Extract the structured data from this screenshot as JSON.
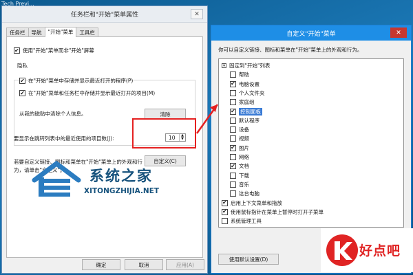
{
  "background": {
    "caption": "Tech Previ..."
  },
  "win1": {
    "title": "任务栏和\"开始\"菜单属性",
    "close": "✕",
    "tabs": [
      "任务栏",
      "导航",
      "\"开始\"菜单",
      "工具栏"
    ],
    "active_tab": 2,
    "use_start_menu": "使用\"开始\"菜单而非\"开始\"屏幕",
    "privacy_label": "隐私",
    "privacy_opt1": "在\"开始\"菜单中存储并显示最近打开的程序(P)",
    "privacy_opt2": "在\"开始\"菜单和任务栏中存储并显示最近打开的项目(M)",
    "clear_history_text": "从我的磁贴中清除个人信息。",
    "clear_button": "清除",
    "jump_list_label": "要显示在跳转列表中的最近使用的项目数(J):",
    "jump_list_value": "10",
    "customize_text_line1": "若要自定义链接、图标和菜单在\"开始\"菜单上的外观和行",
    "customize_text_line2": "为，请单击\"自定义\"。",
    "customize_button": "自定义(C)",
    "ok_button": "确定",
    "cancel_button": "取消",
    "apply_button": "应用(A)"
  },
  "logo": {
    "text": "系统之家",
    "url": "XITONGZHIJIA.NET"
  },
  "win2": {
    "title": "自定义\"开始\"菜单",
    "close": "✕",
    "description": "你可以自定义链接、图标和菜单在\"开始\"菜单上的外观和行为。",
    "items": [
      {
        "label": "固定到\"开始\"列表",
        "checked": "tree",
        "indent": 0
      },
      {
        "label": "帮助",
        "checked": false,
        "indent": 1
      },
      {
        "label": "电脑设置",
        "checked": true,
        "indent": 1
      },
      {
        "label": "个人文件夹",
        "checked": false,
        "indent": 1
      },
      {
        "label": "家庭组",
        "checked": false,
        "indent": 1
      },
      {
        "label": "控制面板",
        "checked": true,
        "indent": 1,
        "selected": true
      },
      {
        "label": "默认程序",
        "checked": false,
        "indent": 1
      },
      {
        "label": "设备",
        "checked": false,
        "indent": 1
      },
      {
        "label": "视频",
        "checked": false,
        "indent": 1
      },
      {
        "label": "图片",
        "checked": true,
        "indent": 1
      },
      {
        "label": "网络",
        "checked": false,
        "indent": 1
      },
      {
        "label": "文档",
        "checked": true,
        "indent": 1
      },
      {
        "label": "下载",
        "checked": false,
        "indent": 1
      },
      {
        "label": "音乐",
        "checked": false,
        "indent": 1
      },
      {
        "label": "这台电脑",
        "checked": false,
        "indent": 1
      },
      {
        "label": "启用上下文菜单和拖放",
        "checked": true,
        "indent": 0
      },
      {
        "label": "使用鼠标指针在菜单上暂停时打开子菜单",
        "checked": true,
        "indent": 0
      },
      {
        "label": "系统管理工具",
        "checked": false,
        "indent": 0
      }
    ],
    "default_button": "使用默认设置(D)"
  },
  "watermark": {
    "text": "好点吧"
  },
  "colors": {
    "accent": "#1e8ee6",
    "highlight_box": "#e52020",
    "selection": "#3a7bd5"
  }
}
